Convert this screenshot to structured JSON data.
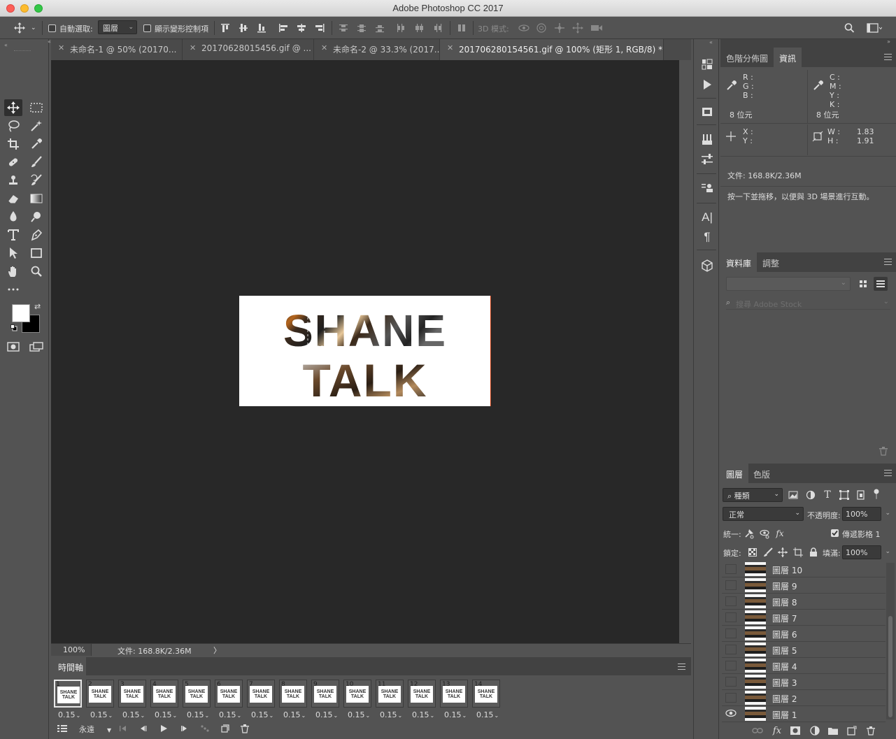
{
  "app": {
    "title": "Adobe Photoshop CC 2017"
  },
  "options_bar": {
    "auto_select_label": "自動選取:",
    "auto_select_target": "圖層",
    "show_transform_label": "顯示變形控制項",
    "mode_3d_label": "3D 模式:"
  },
  "doc_tabs": [
    {
      "label": "未命名-1 @ 50% (20170..."
    },
    {
      "label": "20170628015456.gif @ ..."
    },
    {
      "label": "未命名-2 @ 33.3% (2017..."
    },
    {
      "label": "201706280154561.gif @ 100% (矩形 1, RGB/8) *"
    }
  ],
  "canvas": {
    "line1": "SHANE",
    "line2": "TALK"
  },
  "status_bar": {
    "zoom": "100%",
    "doc_size": "文件: 168.8K/2.36M",
    "arrow": "〉"
  },
  "timeline": {
    "title": "時間軸",
    "loop": "永遠",
    "frames": [
      {
        "num": "1",
        "delay": "0.15"
      },
      {
        "num": "2",
        "delay": "0.15"
      },
      {
        "num": "3",
        "delay": "0.15"
      },
      {
        "num": "4",
        "delay": "0.15"
      },
      {
        "num": "5",
        "delay": "0.15"
      },
      {
        "num": "6",
        "delay": "0.15"
      },
      {
        "num": "7",
        "delay": "0.15"
      },
      {
        "num": "8",
        "delay": "0.15"
      },
      {
        "num": "9",
        "delay": "0.15"
      },
      {
        "num": "10",
        "delay": "0.15"
      },
      {
        "num": "11",
        "delay": "0.15"
      },
      {
        "num": "12",
        "delay": "0.15"
      },
      {
        "num": "13",
        "delay": "0.15"
      },
      {
        "num": "14",
        "delay": "0.15"
      }
    ],
    "selected_frame": 1,
    "thumb_text": "SHANE TALK"
  },
  "info_panel": {
    "tabs": [
      "色階分佈圖",
      "資訊"
    ],
    "active_tab": "資訊",
    "rgb_labels": [
      "R :",
      "G :",
      "B :"
    ],
    "cmyk_labels": [
      "C :",
      "M :",
      "Y :",
      "K :"
    ],
    "bits_left": "8 位元",
    "bits_right": "8 位元",
    "xy_labels": [
      "X :",
      "Y :"
    ],
    "w_label": "W :",
    "w_value": "1.83",
    "h_label": "H :",
    "h_value": "1.91",
    "doc_size": "文件: 168.8K/2.36M",
    "hint": "按一下並拖移，以便與 3D 場景進行互動。"
  },
  "library_panel": {
    "tabs": [
      "資料庫",
      "調整"
    ],
    "active_tab": "資料庫",
    "search_placeholder": "搜尋 Adobe Stock"
  },
  "layers_panel": {
    "tabs": [
      "圖層",
      "色版"
    ],
    "active_tab": "圖層",
    "filter_kind": "種類",
    "blend_mode": "正常",
    "opacity_label": "不透明度:",
    "opacity_value": "100%",
    "unify_label": "統一:",
    "propagate_label": "傳遞影格 1",
    "lock_label": "鎖定:",
    "fill_label": "填滿:",
    "fill_value": "100%",
    "layers": [
      {
        "name": "圖層 10",
        "visible": false
      },
      {
        "name": "圖層 9",
        "visible": false
      },
      {
        "name": "圖層 8",
        "visible": false
      },
      {
        "name": "圖層 7",
        "visible": false
      },
      {
        "name": "圖層 6",
        "visible": false
      },
      {
        "name": "圖層 5",
        "visible": false
      },
      {
        "name": "圖層 4",
        "visible": false
      },
      {
        "name": "圖層 3",
        "visible": false
      },
      {
        "name": "圖層 2",
        "visible": false
      },
      {
        "name": "圖層 1",
        "visible": true
      }
    ]
  },
  "colors": {
    "foreground": "#ffffff",
    "background": "#000000"
  }
}
